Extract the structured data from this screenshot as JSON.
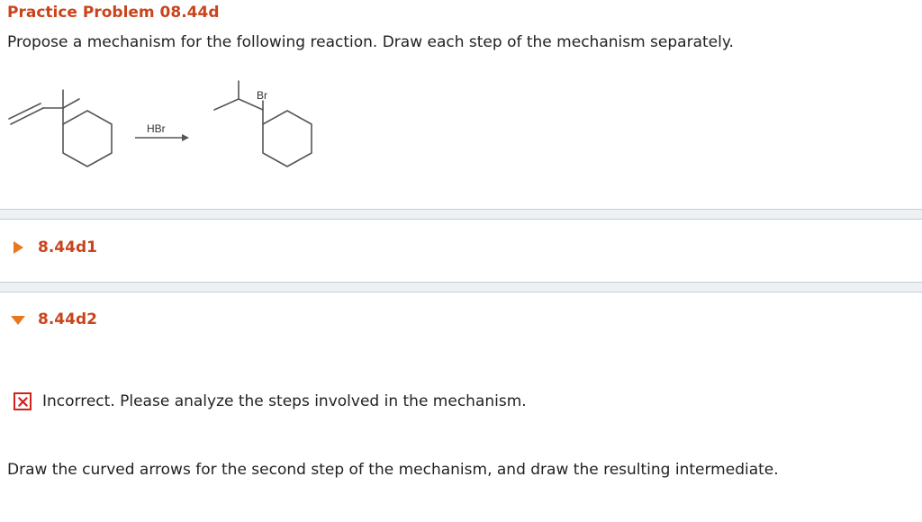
{
  "header": {
    "title": "Practice Problem 08.44d",
    "prompt": "Propose a mechanism for the following reaction. Draw each step of the mechanism separately."
  },
  "reaction": {
    "reagent": "HBr",
    "product_substituent": "Br"
  },
  "sections": [
    {
      "label": "8.44d1",
      "state": "collapsed"
    },
    {
      "label": "8.44d2",
      "state": "expanded"
    }
  ],
  "feedback": {
    "status": "incorrect",
    "message": "Incorrect. Please analyze the steps involved in the mechanism."
  },
  "instruction": "Draw the curved arrows for the second step of the mechanism, and draw the resulting intermediate.",
  "colors": {
    "accent": "#c9441c",
    "caret_collapsed": "#e8781e",
    "error": "#d4201b",
    "divider": "#eef1f4"
  }
}
